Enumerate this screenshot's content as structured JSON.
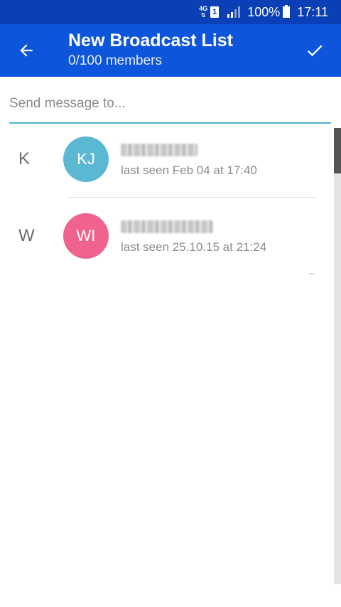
{
  "status_bar": {
    "network": "4G",
    "sim": "1",
    "battery": "100%",
    "time": "17:11"
  },
  "app_bar": {
    "title": "New Broadcast List",
    "subtitle": "0/100 members",
    "back_icon": "arrow-left-icon",
    "confirm_icon": "check-icon"
  },
  "search": {
    "placeholder": "Send message to...",
    "value": ""
  },
  "contacts": [
    {
      "section_letter": "K",
      "initials": "KJ",
      "avatar_color": "#5bb8d3",
      "name": "",
      "status": "last seen Feb 04 at 17:40"
    },
    {
      "section_letter": "W",
      "initials": "WI",
      "avatar_color": "#f0638f",
      "name": "",
      "status": "last seen 25.10.15 at 21:24"
    }
  ],
  "colors": {
    "status_bar": "#0a3fb5",
    "app_bar": "#0d56db",
    "accent_underline": "#4db0d6"
  }
}
